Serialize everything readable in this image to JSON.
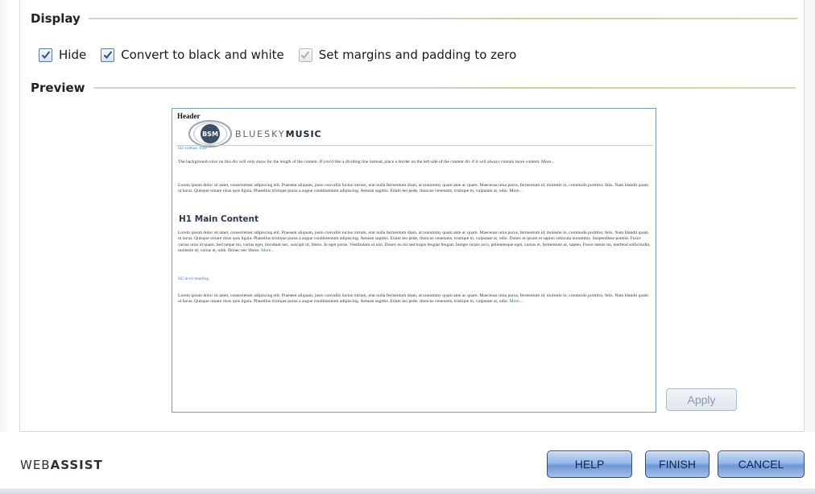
{
  "display": {
    "title": "Display",
    "checkboxes": [
      {
        "label": "Hide",
        "checked": true,
        "enabled": true
      },
      {
        "label": "Convert to black and white",
        "checked": true,
        "enabled": true
      },
      {
        "label": "Set margins and padding to zero",
        "checked": true,
        "enabled": false
      }
    ]
  },
  "preview": {
    "title": "Preview",
    "header_label": "Header",
    "logo_mark": "BSM",
    "logo_text_light": "BLUESKY",
    "logo_text_bold": "MUSIC",
    "sidebar_title": "H2 sidebar Title",
    "sidebar_text": "The background color on this div will only show for the length of the content. If you'd like a dividing line instead, place a border on the left side of the content div if it will always contain more content.",
    "para1": "Lorem ipsum dolor sit amet, consectetuer adipiscing elit. Praesent aliquam, justo convallis luctus rutrum, erat nulla fermentum diam, at nonummy quam ante ac quam. Maecenas urna purus, fermentum id, molestie in, commodo porttitor, felis. Nam blandit quam ut lacus. Quisque ornare risus quis ligula. Phasellus tristique purus a augue condimentum adipiscing. Aenean sagittis. Etiam leo pede, rhoncus venenatis, tristique in, vulputate at, odio.",
    "main_heading": "H1 Main Content",
    "para2": "Lorem ipsum dolor sit amet, consectetuer adipiscing elit. Praesent aliquam, justo convallis luctus rutrum, erat nulla fermentum diam, at nonummy quam ante ac quam. Maecenas urna purus, fermentum id, molestie in, commodo porttitor, felis. Nam blandit quam ut lacus. Quisque ornare risus quis ligula. Phasellus tristique purus a augue condimentum adipiscing. Aenean sagittis. Etiam leo pede, rhoncus venenatis, tristique in, vulputate at, odio. Donec et ipsum et sapien vehicula nonummy. Suspendisse potenti. Fusce varius urna id quam. Sed neque mi, varius eget, tincidunt nec, suscipit id, libero. In eget purus. Vestibulum ut nisl. Donec eu mi sed turpis feugiat feugiat. Integer turpis arcu, pellentesque eget, cursus et, fermentum ut, sapien. Fusce metus mi, eleifend sollicitudin, molestie id, varius et, nibh. Donec nec libero.",
    "sub_heading": "H2 level heading",
    "para3": "Lorem ipsum dolor sit amet, consectetuer adipiscing elit. Praesent aliquam, justo convallis luctus rutrum, erat nulla fermentum diam, at nonummy quam ante ac quam. Maecenas urna purus, fermentum id, molestie in, commodo porttitor, felis. Nam blandit quam ut lacus. Quisque ornare risus quis ligula. Phasellus tristique purus a augue condimentum adipiscing. Aenean sagittis. Etiam leo pede, rhoncus venenatis, tristique in, vulputate at, odio.",
    "more_link": "More..."
  },
  "apply_label": "Apply",
  "footer": {
    "brand_light": "WEB",
    "brand_bold": "ASSIST",
    "help_label": "HELP",
    "finish_label": "FINISH",
    "cancel_label": "CANCEL"
  },
  "colors": {
    "button_blue": "#97b9e8",
    "frame_border": "#7a9cbf",
    "link_blue": "#2f67b3"
  },
  "icons": {
    "checkbox_checked": "checkmark-icon",
    "logo": "bluesky-music-logo"
  }
}
